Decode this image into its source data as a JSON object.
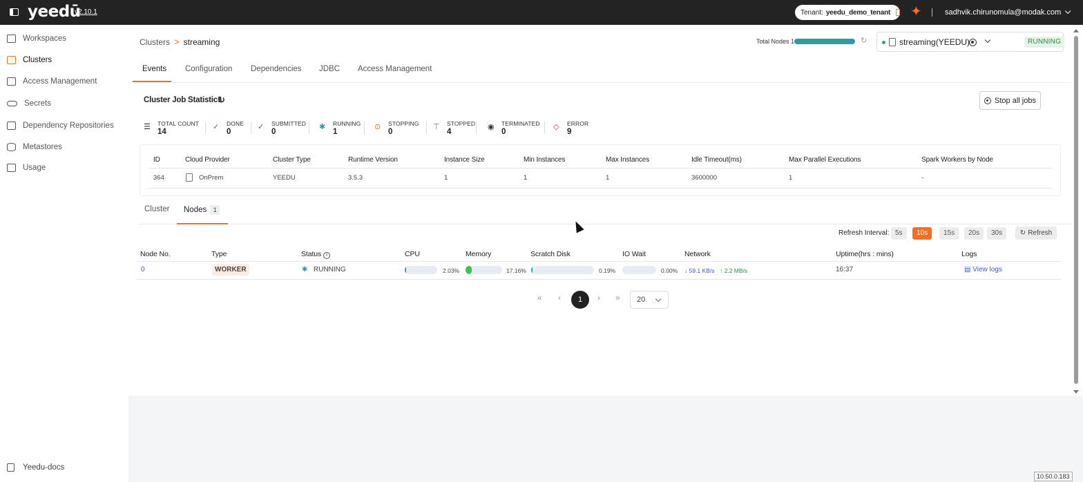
{
  "topbar": {
    "logo": "yeedū",
    "version": "v2.10.1",
    "tenant_label": "Tenant:",
    "tenant_name": "yeedu_demo_tenant",
    "user_email": "sadhvik.chirunomula@modak.com"
  },
  "sidebar": {
    "items": [
      {
        "label": "Workspaces",
        "icon": "workspace-icon"
      },
      {
        "label": "Clusters",
        "icon": "clusters-icon"
      },
      {
        "label": "Access Management",
        "icon": "access-icon"
      },
      {
        "label": "Secrets",
        "icon": "key-icon"
      },
      {
        "label": "Dependency Repositories",
        "icon": "repo-icon"
      },
      {
        "label": "Metastores",
        "icon": "database-icon"
      },
      {
        "label": "Usage",
        "icon": "usage-icon"
      }
    ],
    "docs": "Yeedu-docs"
  },
  "breadcrumb": {
    "parent": "Clusters",
    "separator": ">",
    "current": "streaming"
  },
  "header": {
    "total_nodes_label": "Total Nodes 1",
    "cluster_name": "streaming(YEEDU)",
    "status": "RUNNING",
    "status_color": "#2b8a3e"
  },
  "tabs": [
    "Events",
    "Configuration",
    "Dependencies",
    "JDBC",
    "Access Management"
  ],
  "stats": {
    "title": "Cluster Job Statistics",
    "stop_all": "Stop all jobs",
    "items": [
      {
        "label": "TOTAL COUNT",
        "value": "14",
        "icon": "list-icon"
      },
      {
        "label": "DONE",
        "value": "0",
        "icon": "check-circle-icon"
      },
      {
        "label": "SUBMITTED",
        "value": "0",
        "icon": "double-check-icon"
      },
      {
        "label": "RUNNING",
        "value": "1",
        "icon": "running-icon"
      },
      {
        "label": "STOPPING",
        "value": "0",
        "icon": "stopping-icon"
      },
      {
        "label": "STOPPED",
        "value": "4",
        "icon": "stopped-icon"
      },
      {
        "label": "TERMINATED",
        "value": "0",
        "icon": "terminated-icon"
      },
      {
        "label": "ERROR",
        "value": "9",
        "icon": "error-icon"
      }
    ]
  },
  "cluster_table": {
    "headers": [
      "ID",
      "Cloud Provider",
      "Cluster Type",
      "Runtime Version",
      "Instance Size",
      "Min Instances",
      "Max Instances",
      "Idle Timeout(ms)",
      "Max Parallel Executions",
      "Spark Workers by Node"
    ],
    "row": [
      "364",
      "OnPrem",
      "YEEDU",
      "3.5.3",
      "1",
      "1",
      "1",
      "3600000",
      "1",
      "-"
    ]
  },
  "subtabs": {
    "cluster": "Cluster",
    "nodes": "Nodes",
    "nodes_count": "1"
  },
  "refresh": {
    "label": "Refresh Interval:",
    "options": [
      "5s",
      "10s",
      "15s",
      "20s",
      "30s"
    ],
    "selected": "10s",
    "button": "Refresh",
    "accent": "#f36f21"
  },
  "nodes_table": {
    "headers": [
      "Node No.",
      "Type",
      "Status",
      "CPU",
      "Memory",
      "Scratch Disk",
      "IO Wait",
      "Network",
      "Uptime(hrs : mins)",
      "Logs"
    ],
    "row": {
      "node_no": "0",
      "type": "WORKER",
      "status": "RUNNING",
      "cpu": "2.03%",
      "cpu_fraction": 0.0203,
      "memory": "17.16%",
      "memory_fraction": 0.1716,
      "scratch": "0.19%",
      "scratch_fraction": 0.0019,
      "io_wait": "0.00%",
      "io_fraction": 0,
      "net_down": "59.1 KB/s",
      "net_up": "2.2 MB/s",
      "uptime": "16:37",
      "logs": "View logs"
    }
  },
  "pagination": {
    "first": "«",
    "prev": "‹",
    "current": "1",
    "next": "›",
    "last": "»",
    "page_size": "20"
  },
  "footer": {
    "ip": "10.50.0.183"
  }
}
